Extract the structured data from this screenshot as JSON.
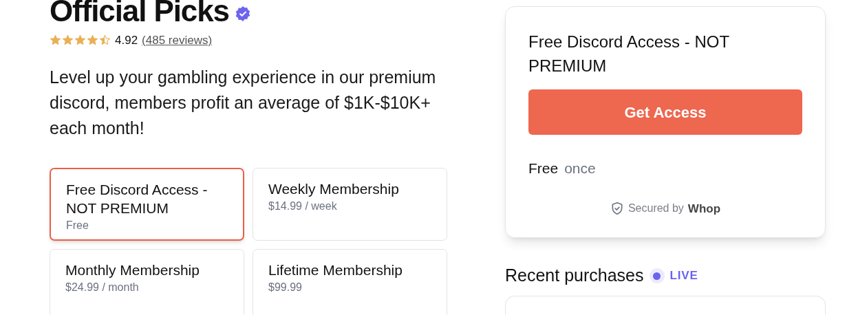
{
  "title": "Official Picks",
  "verified": true,
  "rating": {
    "stars": 4.5,
    "score": "4.92",
    "reviews": "(485 reviews)"
  },
  "description": "Level up your gambling experience in our premium discord, members profit an average of $1K-$10K+ each month!",
  "plans": [
    {
      "name": "Free Discord Access - NOT PREMIUM",
      "price": "Free",
      "selected": true
    },
    {
      "name": "Weekly Membership",
      "price": "$14.99 / week",
      "selected": false
    },
    {
      "name": "Monthly Membership",
      "price": "$24.99 / month",
      "selected": false
    },
    {
      "name": "Lifetime Membership",
      "price": "$99.99",
      "selected": false
    }
  ],
  "checkout": {
    "plan_name": "Free Discord Access - NOT PREMIUM",
    "button": "Get Access",
    "price": "Free",
    "period": "once",
    "secured_by": "Secured by",
    "brand": "Whop"
  },
  "recent": {
    "title": "Recent purchases",
    "live": "LIVE"
  }
}
